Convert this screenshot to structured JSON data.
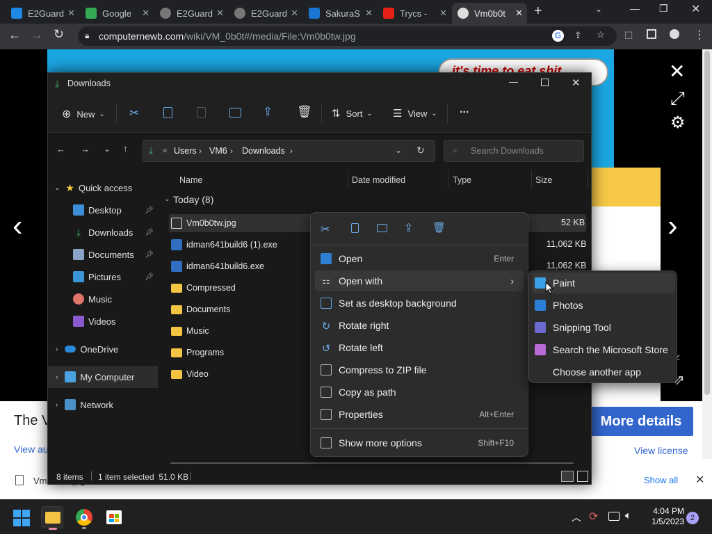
{
  "browser": {
    "tabs": [
      {
        "title": "E2Guard",
        "icon": "bing-icon"
      },
      {
        "title": "Google",
        "icon": "google-maps-icon"
      },
      {
        "title": "E2Guard",
        "icon": "globe-icon"
      },
      {
        "title": "E2Guard",
        "icon": "globe-icon"
      },
      {
        "title": "SakuraS",
        "icon": "ibb-icon"
      },
      {
        "title": "Trycs - ",
        "icon": "youtube-icon"
      },
      {
        "title": "Vm0b0t",
        "icon": "fandom-icon"
      }
    ],
    "new_tab_label": "+",
    "url_host": "computernewb.com",
    "url_path": "/wiki/VM_0b0t#/media/File:Vm0b0tw.jpg"
  },
  "page": {
    "speech_text": "it's time to eat shit",
    "title_partial": "The V",
    "view_author_partial": "View au",
    "more_details": "More details",
    "view_license": "View license"
  },
  "download_shelf": {
    "item": "Vm0b0tw.jpg",
    "show_all": "Show all"
  },
  "explorer": {
    "title": "Downloads",
    "toolbar": {
      "new": "New",
      "sort": "Sort",
      "view": "View",
      "more": "..."
    },
    "path": [
      "Users",
      "VM6",
      "Downloads"
    ],
    "search_placeholder": "Search Downloads",
    "nav": {
      "quick_access": "Quick access",
      "items": [
        {
          "label": "Desktop",
          "pinned": true
        },
        {
          "label": "Downloads",
          "pinned": true
        },
        {
          "label": "Documents",
          "pinned": true
        },
        {
          "label": "Pictures",
          "pinned": true
        },
        {
          "label": "Music",
          "pinned": false
        },
        {
          "label": "Videos",
          "pinned": false
        }
      ],
      "onedrive": "OneDrive",
      "my_computer": "My Computer",
      "network": "Network"
    },
    "columns": {
      "name": "Name",
      "date": "Date modified",
      "type": "Type",
      "size": "Size"
    },
    "group": "Today (8)",
    "files": [
      {
        "name": "Vm0b0tw.jpg",
        "size": "52 KB",
        "kind": "image"
      },
      {
        "name": "idman641build6 (1).exe",
        "size": "11,062 KB",
        "kind": "exe"
      },
      {
        "name": "idman641build6.exe",
        "size": "11,062 KB",
        "kind": "exe"
      },
      {
        "name": "Compressed",
        "size": "",
        "kind": "folder"
      },
      {
        "name": "Documents",
        "size": "",
        "kind": "folder"
      },
      {
        "name": "Music",
        "size": "",
        "kind": "folder"
      },
      {
        "name": "Programs",
        "size": "",
        "kind": "folder"
      },
      {
        "name": "Video",
        "size": "",
        "kind": "folder"
      }
    ],
    "status": {
      "count": "8 items",
      "selected": "1 item selected  51.0 KB"
    }
  },
  "context_menu": {
    "items": [
      {
        "label": "Open",
        "shortcut": "Enter",
        "icon": "open-image-icon"
      },
      {
        "label": "Open with",
        "shortcut": "",
        "icon": "open-with-icon"
      },
      {
        "label": "Set as desktop background",
        "shortcut": "",
        "icon": "wallpaper-icon"
      },
      {
        "label": "Rotate right",
        "shortcut": "",
        "icon": "rotate-right-icon"
      },
      {
        "label": "Rotate left",
        "shortcut": "",
        "icon": "rotate-left-icon"
      },
      {
        "label": "Compress to ZIP file",
        "shortcut": "",
        "icon": "zip-icon"
      },
      {
        "label": "Copy as path",
        "shortcut": "",
        "icon": "copy-path-icon"
      },
      {
        "label": "Properties",
        "shortcut": "Alt+Enter",
        "icon": "properties-icon"
      },
      {
        "label": "Show more options",
        "shortcut": "Shift+F10",
        "icon": "more-options-icon"
      }
    ]
  },
  "open_with_menu": {
    "items": [
      {
        "label": "Paint",
        "color": "#3aa0e8"
      },
      {
        "label": "Photos",
        "color": "#2b7fd6"
      },
      {
        "label": "Snipping Tool",
        "color": "#6b6bd0"
      },
      {
        "label": "Search the Microsoft Store",
        "color": "#b86ad6"
      },
      {
        "label": "Choose another app",
        "color": ""
      }
    ]
  },
  "taskbar": {
    "time": "4:04 PM",
    "date": "1/5/2023",
    "notifications": "2"
  },
  "colors": {
    "accent": "#0078d4",
    "folder": "#f4c542",
    "link": "#3366cc"
  }
}
